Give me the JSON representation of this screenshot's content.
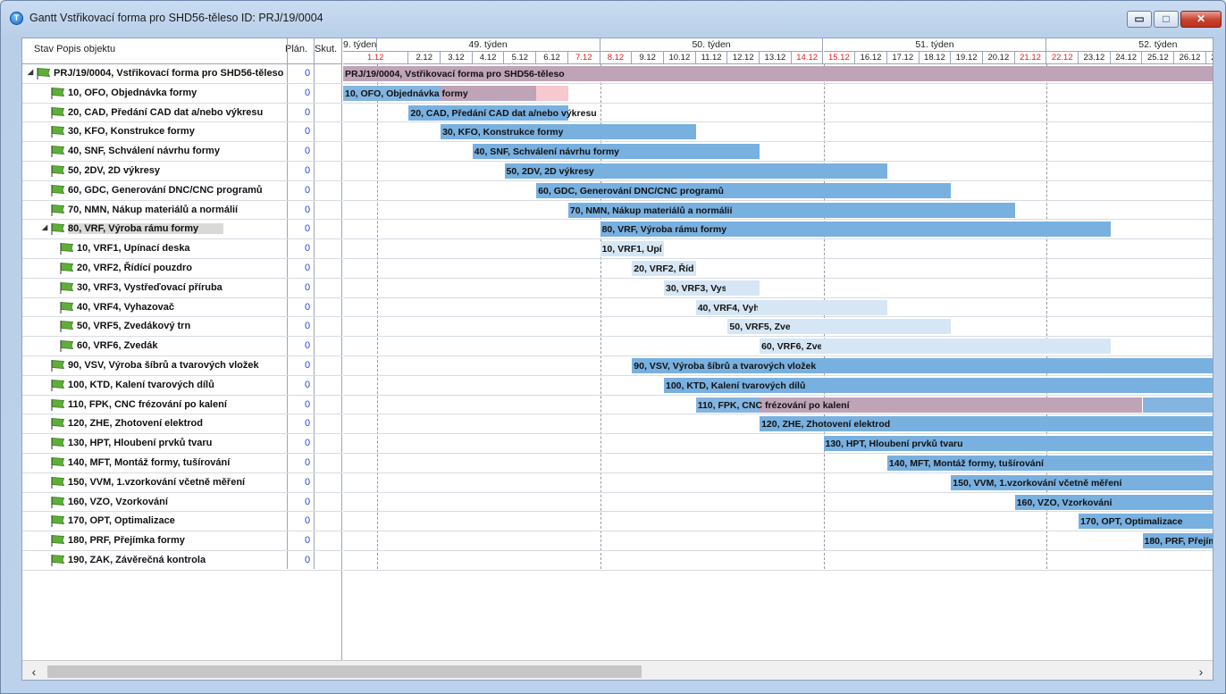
{
  "window": {
    "title": "Gantt Vstřikovací forma pro SHD56-těleso ID: PRJ/19/0004",
    "min_label": "▭",
    "max_label": "□",
    "close_label": "✕",
    "app_icon": "T"
  },
  "columns": {
    "name": "Stav Popis objektu",
    "plan": "Plán.",
    "skut": "Skut."
  },
  "weeks": [
    "9. týden",
    "49. týden",
    "50. týden",
    "51. týden",
    "52. týden"
  ],
  "days": [
    {
      "label": "1.12",
      "weekend": true
    },
    {
      "label": "2.12",
      "weekend": false
    },
    {
      "label": "3.12",
      "weekend": false
    },
    {
      "label": "4.12",
      "weekend": false
    },
    {
      "label": "5.12",
      "weekend": false
    },
    {
      "label": "6.12",
      "weekend": false
    },
    {
      "label": "7.12",
      "weekend": true
    },
    {
      "label": "8.12",
      "weekend": true
    },
    {
      "label": "9.12",
      "weekend": false
    },
    {
      "label": "10.12",
      "weekend": false
    },
    {
      "label": "11.12",
      "weekend": false
    },
    {
      "label": "12.12",
      "weekend": false
    },
    {
      "label": "13.12",
      "weekend": false
    },
    {
      "label": "14.12",
      "weekend": true
    },
    {
      "label": "15.12",
      "weekend": true
    },
    {
      "label": "16.12",
      "weekend": false
    },
    {
      "label": "17.12",
      "weekend": false
    },
    {
      "label": "18.12",
      "weekend": false
    },
    {
      "label": "19.12",
      "weekend": false
    },
    {
      "label": "20.12",
      "weekend": false
    },
    {
      "label": "21.12",
      "weekend": true
    },
    {
      "label": "22.12",
      "weekend": true
    },
    {
      "label": "23.12",
      "weekend": false
    },
    {
      "label": "24.12",
      "weekend": false
    },
    {
      "label": "25.12",
      "weekend": false
    },
    {
      "label": "26.12",
      "weekend": false
    },
    {
      "label": "27.12",
      "weekend": false
    },
    {
      "label": "2",
      "weekend": true
    }
  ],
  "tasks": [
    {
      "name": "PRJ/19/0004, Vstřikovací forma pro SHD56-těleso",
      "plan": "0",
      "level": 0,
      "expander": "◢",
      "bar_label": "PRJ/19/0004, Vstřikovací forma pro SHD56-těleso",
      "bar_color": "#bfa3b7",
      "bar_color2": "",
      "start": 0,
      "end": 28,
      "split": null
    },
    {
      "name": "10, OFO, Objednávka formy",
      "plan": "0",
      "level": 1,
      "expander": "",
      "bar_label": "10, OFO, Objednávka formy",
      "bar_color": "#84b5e0",
      "bar_color2": "#bfa3b7",
      "start": 0,
      "end": 6,
      "split": 2,
      "pink": [
        5,
        6
      ]
    },
    {
      "name": "20, CAD, Předání CAD dat a/nebo výkresu",
      "plan": "0",
      "level": 1,
      "expander": "",
      "bar_label": "20, CAD, Předání CAD dat a/nebo výkresu",
      "bar_color": "#78b0e0",
      "bar_color2": "",
      "start": 1,
      "end": 6,
      "split": null
    },
    {
      "name": "30, KFO, Konstrukce formy",
      "plan": "0",
      "level": 1,
      "expander": "",
      "bar_label": "30, KFO, Konstrukce formy",
      "bar_color": "#78b0e0",
      "bar_color2": "",
      "start": 2,
      "end": 10,
      "split": null
    },
    {
      "name": "40, SNF, Schválení návrhu formy",
      "plan": "0",
      "level": 1,
      "expander": "",
      "bar_label": "40, SNF, Schválení návrhu formy",
      "bar_color": "#78b0e0",
      "bar_color2": "",
      "start": 3,
      "end": 12,
      "split": null
    },
    {
      "name": "50, 2DV, 2D výkresy",
      "plan": "0",
      "level": 1,
      "expander": "",
      "bar_label": "50, 2DV, 2D výkresy",
      "bar_color": "#78b0e0",
      "bar_color2": "",
      "start": 4,
      "end": 16,
      "split": null
    },
    {
      "name": "60, GDC, Generování DNC/CNC programů",
      "plan": "0",
      "level": 1,
      "expander": "",
      "bar_label": "60, GDC, Generování DNC/CNC programů",
      "bar_color": "#78b0e0",
      "bar_color2": "",
      "start": 5,
      "end": 18,
      "split": null
    },
    {
      "name": "70, NMN, Nákup materiálů a normálií",
      "plan": "0",
      "level": 1,
      "expander": "",
      "bar_label": "70, NMN, Nákup materiálů a normálií",
      "bar_color": "#78b0e0",
      "bar_color2": "",
      "start": 6,
      "end": 20,
      "split": null
    },
    {
      "name": "80, VRF, Výroba rámu formy",
      "plan": "0",
      "level": 1,
      "expander": "◢",
      "selected": true,
      "bar_label": "80, VRF, Výroba rámu formy",
      "bar_color": "#78b0e0",
      "bar_color2": "",
      "start": 7,
      "end": 23,
      "split": null
    },
    {
      "name": "10, VRF1, Upínací deska",
      "plan": "0",
      "level": 2,
      "expander": "",
      "bar_label": "10, VRF1, Upínací deska",
      "bar_color": "#d6e6f4",
      "bar_color2": "",
      "start": 7,
      "end": 9,
      "split": null
    },
    {
      "name": "20, VRF2, Řídící pouzdro",
      "plan": "0",
      "level": 2,
      "expander": "",
      "bar_label": "20, VRF2, Řídící pouzdro",
      "bar_color": "#d6e6f4",
      "bar_color2": "",
      "start": 8,
      "end": 10,
      "split": null
    },
    {
      "name": "30, VRF3, Vystřeďovací příruba",
      "plan": "0",
      "level": 2,
      "expander": "",
      "bar_label": "30, VRF3, Vystřeďovací příruba",
      "bar_color": "#d6e6f4",
      "bar_color2": "",
      "start": 9,
      "end": 12,
      "split": null
    },
    {
      "name": "40, VRF4, Vyhazovač",
      "plan": "0",
      "level": 2,
      "expander": "",
      "bar_label": "40, VRF4, Vyhazovač",
      "bar_color": "#d6e6f4",
      "bar_color2": "",
      "start": 10,
      "end": 16,
      "split": null
    },
    {
      "name": "50, VRF5, Zvedákový trn",
      "plan": "0",
      "level": 2,
      "expander": "",
      "bar_label": "50, VRF5, Zvedákový trn",
      "bar_color": "#d6e6f4",
      "bar_color2": "",
      "start": 11,
      "end": 18,
      "split": null
    },
    {
      "name": "60, VRF6, Zvedák",
      "plan": "0",
      "level": 2,
      "expander": "",
      "bar_label": "60, VRF6, Zvedák",
      "bar_color": "#d6e6f4",
      "bar_color2": "",
      "start": 12,
      "end": 23,
      "split": null
    },
    {
      "name": "90, VSV, Výroba šíbrů a tvarových vložek",
      "plan": "0",
      "level": 1,
      "expander": "",
      "bar_label": "90, VSV, Výroba šíbrů a tvarových vložek",
      "bar_color": "#78b0e0",
      "bar_color2": "",
      "start": 8,
      "end": 28,
      "split": null
    },
    {
      "name": "100, KTD, Kalení tvarových dílů",
      "plan": "0",
      "level": 1,
      "expander": "",
      "bar_label": "100, KTD, Kalení tvarových dílů",
      "bar_color": "#78b0e0",
      "bar_color2": "",
      "start": 9,
      "end": 28,
      "split": null
    },
    {
      "name": "110, FPK, CNC frézování po kalení",
      "plan": "0",
      "level": 1,
      "expander": "",
      "bar_label": "110, FPK, CNC frézování po kalení",
      "bar_color": "#84b5e0",
      "bar_color2": "#bfa3b7",
      "start": 10,
      "end": 28,
      "split": 12,
      "split_end": 24
    },
    {
      "name": "120, ZHE, Zhotovení elektrod",
      "plan": "0",
      "level": 1,
      "expander": "",
      "bar_label": "120, ZHE, Zhotovení elektrod",
      "bar_color": "#78b0e0",
      "bar_color2": "",
      "start": 12,
      "end": 28,
      "split": null
    },
    {
      "name": "130, HPT, Hloubení prvků tvaru",
      "plan": "0",
      "level": 1,
      "expander": "",
      "bar_label": "130, HPT, Hloubení prvků tvaru",
      "bar_color": "#78b0e0",
      "bar_color2": "",
      "start": 14,
      "end": 28,
      "split": null
    },
    {
      "name": "140, MFT, Montáž formy, tušírování",
      "plan": "0",
      "level": 1,
      "expander": "",
      "bar_label": "140, MFT, Montáž formy, tušírování",
      "bar_color": "#78b0e0",
      "bar_color2": "",
      "start": 16,
      "end": 28,
      "split": null
    },
    {
      "name": "150, VVM, 1.vzorkování včetně měření",
      "plan": "0",
      "level": 1,
      "expander": "",
      "bar_label": "150, VVM, 1.vzorkování včetně měření",
      "bar_color": "#78b0e0",
      "bar_color2": "",
      "start": 18,
      "end": 28,
      "split": null
    },
    {
      "name": "160, VZO, Vzorkování",
      "plan": "0",
      "level": 1,
      "expander": "",
      "bar_label": "160, VZO, Vzorkování",
      "bar_color": "#78b0e0",
      "bar_color2": "",
      "start": 20,
      "end": 28,
      "split": null
    },
    {
      "name": "170, OPT, Optimalizace",
      "plan": "0",
      "level": 1,
      "expander": "",
      "bar_label": "170, OPT, Optimalizace",
      "bar_color": "#78b0e0",
      "bar_color2": "",
      "start": 22,
      "end": 28,
      "split": null
    },
    {
      "name": "180, PRF, Přejímka formy",
      "plan": "0",
      "level": 1,
      "expander": "",
      "bar_label": "180, PRF, Přejímka formy",
      "bar_color": "#78b0e0",
      "bar_color2": "",
      "start": 24,
      "end": 28,
      "split": null
    },
    {
      "name": "190, ZAK, Závěrečná kontrola",
      "plan": "0",
      "level": 1,
      "expander": "",
      "bar_label": "",
      "bar_color": "",
      "bar_color2": "",
      "start": null,
      "end": null,
      "split": null
    }
  ],
  "scrollbar": {
    "left_arrow": "‹",
    "right_arrow": "›",
    "position": 0.5
  },
  "colors": {
    "flag": "#5fae3a",
    "bar": "#78b0e0",
    "sub_bar": "#d6e6f4",
    "overrun": "#bfa3b7",
    "weekend": "#e02020"
  }
}
